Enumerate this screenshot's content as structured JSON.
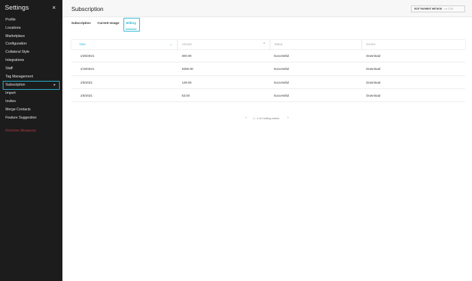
{
  "sidebar": {
    "title": "Settings",
    "close_icon": "×",
    "items": [
      {
        "label": "Profile"
      },
      {
        "label": "Locations"
      },
      {
        "label": "Marketplace"
      },
      {
        "label": "Configuration"
      },
      {
        "label": "Collateral Style"
      },
      {
        "label": "Integrations"
      },
      {
        "label": "Staff"
      },
      {
        "label": "Tag Management"
      },
      {
        "label": "Subscription"
      },
      {
        "label": "Import"
      },
      {
        "label": "Invites"
      },
      {
        "label": "Merge Contacts"
      },
      {
        "label": "Feature Suggestion"
      }
    ],
    "active_index": 8,
    "logout_label": "Firmnine Measures",
    "logout_color": "#b23a48"
  },
  "header": {
    "title": "Subscription",
    "edit_payment_label": "EDIT PAYMENT METHOD",
    "edit_payment_card": "•••• 1234"
  },
  "tabs": [
    {
      "label": "Subscription"
    },
    {
      "label": "Current Usage"
    },
    {
      "label": "Billing"
    }
  ],
  "active_tab": "Billing",
  "accent_color": "#29b6d3",
  "table": {
    "columns": [
      "Date",
      "Amount",
      "Status",
      "Invoice"
    ],
    "rows": [
      {
        "date": "1/26/2021",
        "amount": "300.00",
        "status": "Successful",
        "invoice": "Download"
      },
      {
        "date": "1/19/2021",
        "amount": "4060.00",
        "status": "Successful",
        "invoice": "Download"
      },
      {
        "date": "1/6/2021",
        "amount": "149.00",
        "status": "Successful",
        "invoice": "Download"
      },
      {
        "date": "1/6/2021",
        "amount": "53.00",
        "status": "Successful",
        "invoice": "Download"
      }
    ]
  },
  "pagination": {
    "text": "1 - 4 of 4 billing entries"
  }
}
